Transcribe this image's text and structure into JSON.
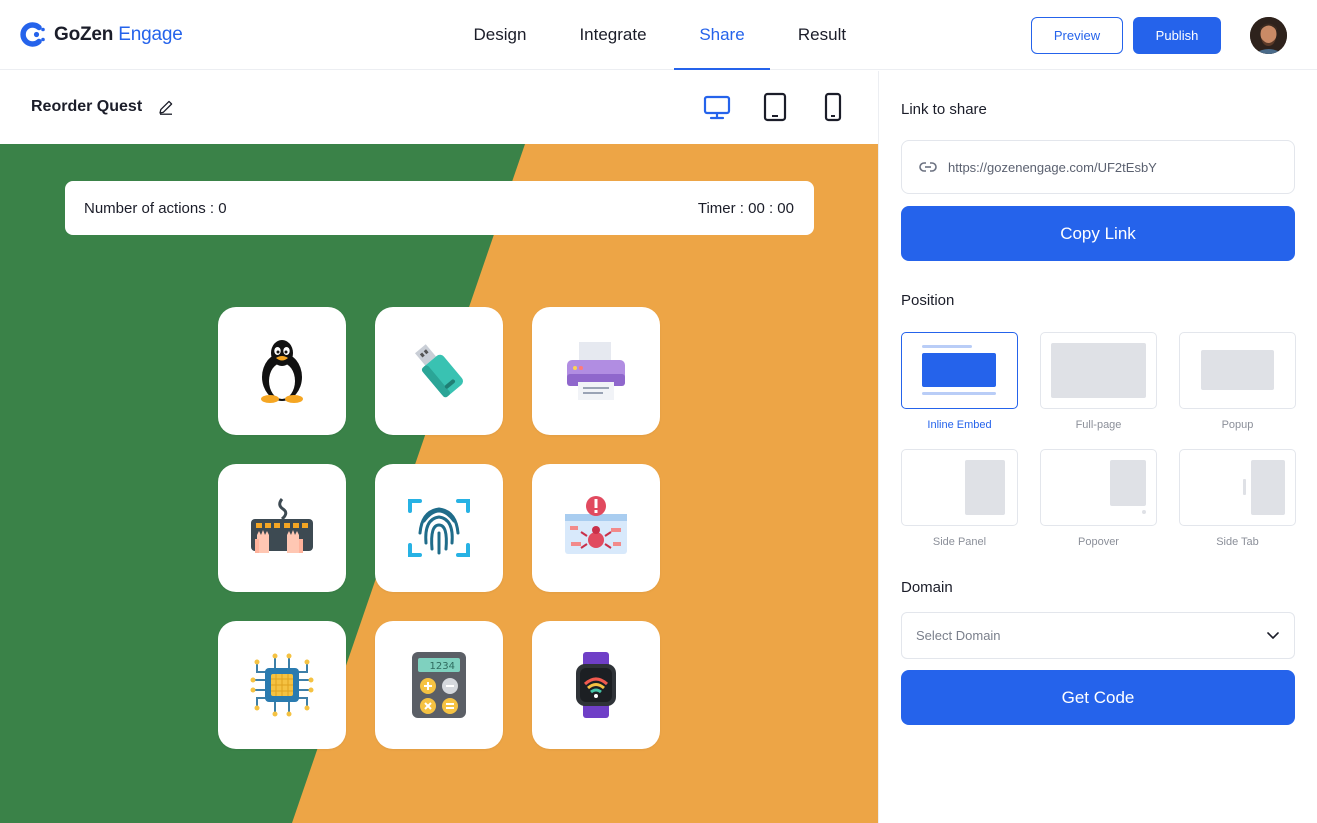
{
  "brand": {
    "name_part1": "GoZen",
    "name_part2": "Engage",
    "accent": "#2563eb"
  },
  "nav": {
    "tabs": [
      "Design",
      "Integrate",
      "Share",
      "Result"
    ],
    "active": "Share"
  },
  "header": {
    "preview_label": "Preview",
    "publish_label": "Publish"
  },
  "editor": {
    "title": "Reorder Quest",
    "devices": [
      "desktop-icon",
      "tablet-icon",
      "mobile-icon"
    ],
    "active_device": "desktop"
  },
  "game": {
    "actions_label": "Number of actions : 0",
    "timer_label": "Timer : 00 : 00",
    "background_colors": {
      "left": "#3a8248",
      "right": "#eda546"
    },
    "tiles": [
      "linux-penguin-icon",
      "usb-drive-icon",
      "printer-icon",
      "keyboard-typing-icon",
      "fingerprint-icon",
      "bug-alert-icon",
      "microchip-icon",
      "calculator-icon",
      "smartwatch-icon"
    ],
    "calculator_display": "1234"
  },
  "share": {
    "link_label": "Link to share",
    "link_url": "https://gozenengage.com/UF2tEsbY",
    "copy_label": "Copy Link",
    "position_label": "Position",
    "positions": [
      {
        "label": "Inline Embed",
        "selected": true
      },
      {
        "label": "Full-page",
        "selected": false
      },
      {
        "label": "Popup",
        "selected": false
      },
      {
        "label": "Side Panel",
        "selected": false
      },
      {
        "label": "Popover",
        "selected": false
      },
      {
        "label": "Side Tab",
        "selected": false
      }
    ],
    "domain_label": "Domain",
    "domain_placeholder": "Select Domain",
    "get_code_label": "Get Code"
  }
}
